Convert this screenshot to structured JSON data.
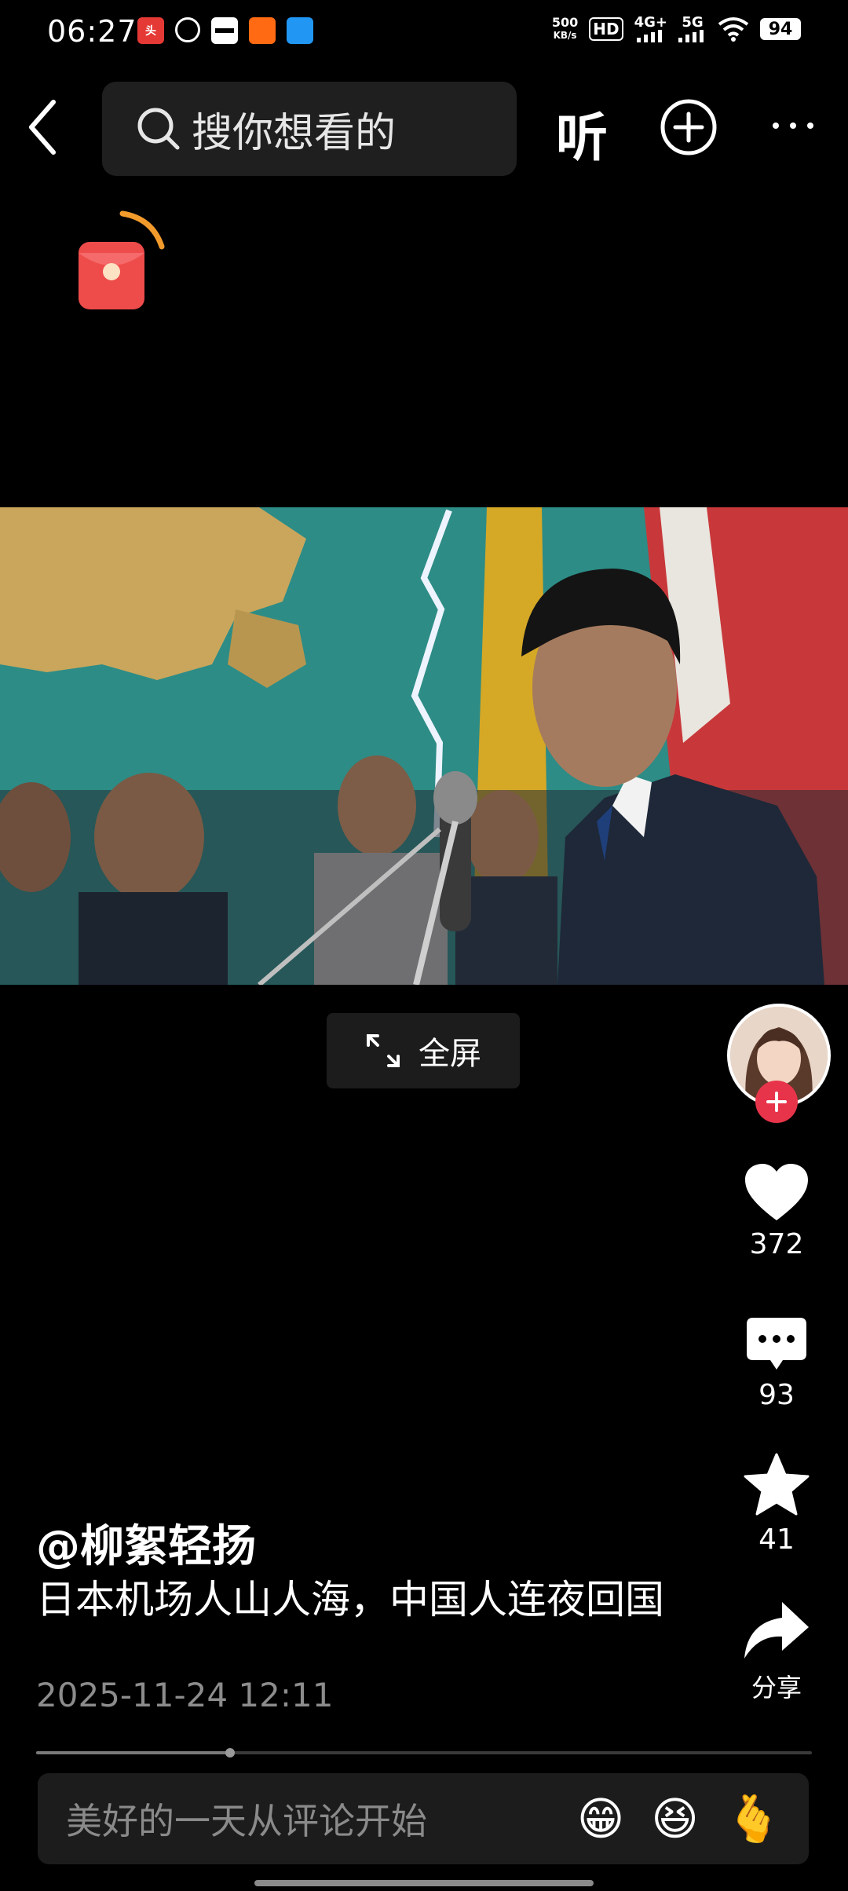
{
  "status_bar": {
    "time": "06:27",
    "net_speed_value": "500",
    "net_speed_unit": "KB/s",
    "hd_label": "HD",
    "network_4g": "4G+",
    "network_5g": "5G",
    "battery": "94",
    "notif_icons": [
      "toutiao-icon",
      "app-icon",
      "bus-card-icon",
      "taobao-icon",
      "browser-icon"
    ]
  },
  "top_bar": {
    "search_placeholder": "搜你想看的",
    "listen_label": "听"
  },
  "video": {
    "fullscreen_label": "全屏"
  },
  "rail": {
    "likes": "372",
    "comments": "93",
    "favorites": "41",
    "share_label": "分享"
  },
  "post": {
    "author": "@柳絮轻扬",
    "description": "日本机场人山人海，中国人连夜回国",
    "timestamp": "2025-11-24 12:11",
    "progress": 0.25
  },
  "comment_bar": {
    "placeholder": "美好的一天从评论开始",
    "emojis": [
      "😁",
      "😆",
      "🫰"
    ]
  },
  "colors": {
    "accent_red": "#e8344a",
    "background": "#000000"
  }
}
